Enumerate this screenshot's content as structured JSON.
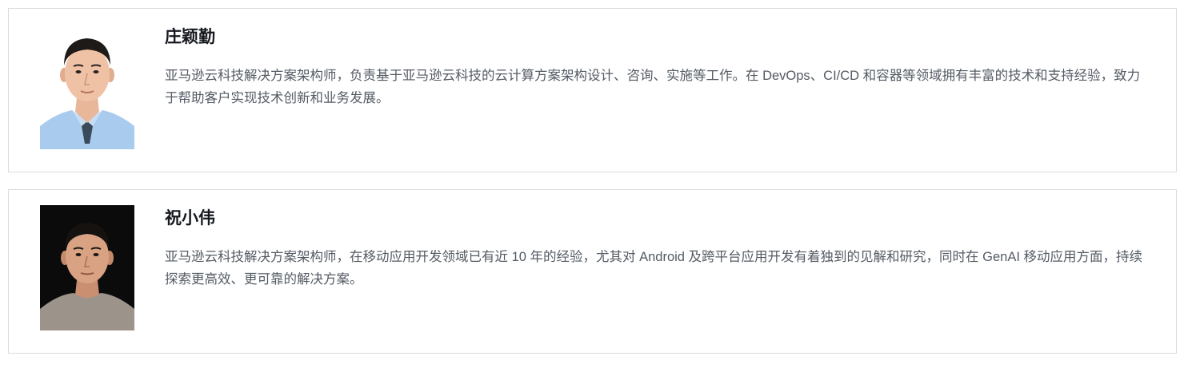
{
  "profiles": [
    {
      "name": "庄颖勤",
      "bio": "亚马逊云科技解决方案架构师，负责基于亚马逊云科技的云计算方案架构设计、咨询、实施等工作。在 DevOps、CI/CD 和容器等领域拥有丰富的技术和支持经验，致力于帮助客户实现技术创新和业务发展。",
      "photo_bg": "#ffffff"
    },
    {
      "name": "祝小伟",
      "bio": "亚马逊云科技解决方案架构师，在移动应用开发领域已有近 10 年的经验，尤其对 Android 及跨平台应用开发有着独到的见解和研究，同时在 GenAI 移动应用方面，持续探索更高效、更可靠的解决方案。",
      "photo_bg": "#0b0b0b"
    }
  ]
}
